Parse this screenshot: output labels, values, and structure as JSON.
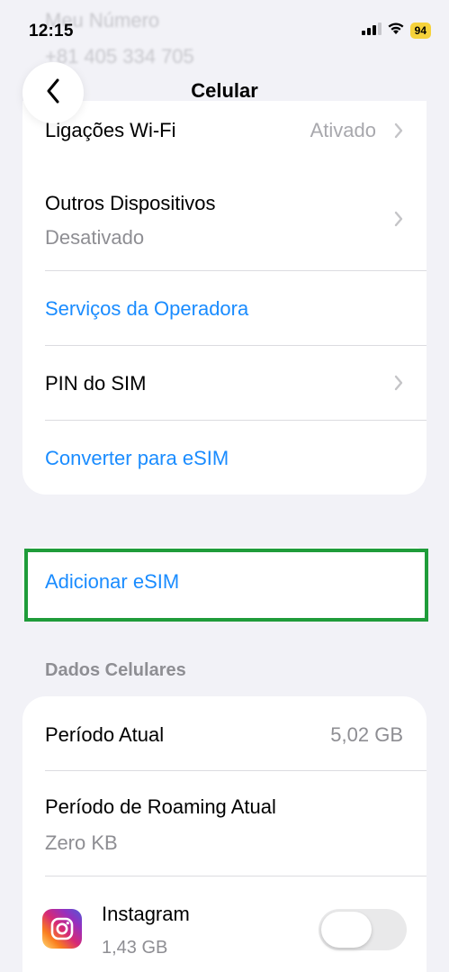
{
  "status_bar": {
    "time": "12:15",
    "battery_level": "94",
    "battery_color": "#f6d23b"
  },
  "ghost": {
    "my_number_label": "Meu Número",
    "my_number_value": "+81 405 334 705"
  },
  "nav": {
    "title": "Celular"
  },
  "settings": {
    "wifi_calling": {
      "label": "Ligações Wi-Fi",
      "value": "Ativado"
    },
    "other_devices": {
      "label": "Outros Dispositivos",
      "value": "Desativado"
    },
    "carrier_services": {
      "label": "Serviços da Operadora"
    },
    "sim_pin": {
      "label": "PIN do SIM"
    },
    "convert_esim": {
      "label": "Converter para eSIM"
    }
  },
  "add_esim": {
    "label": "Adicionar eSIM"
  },
  "cellular_data": {
    "header": "Dados Celulares",
    "current_period": {
      "label": "Período Atual",
      "value": "5,02 GB"
    },
    "roaming_period": {
      "label": "Período de Roaming Atual",
      "value": "Zero KB"
    },
    "apps": [
      {
        "name": "Instagram",
        "usage": "1,43 GB",
        "enabled": false,
        "icon": "instagram-icon"
      }
    ]
  },
  "colors": {
    "link": "#1a8cff",
    "highlight": "#1f9c3a",
    "background": "#f2f2f7"
  }
}
